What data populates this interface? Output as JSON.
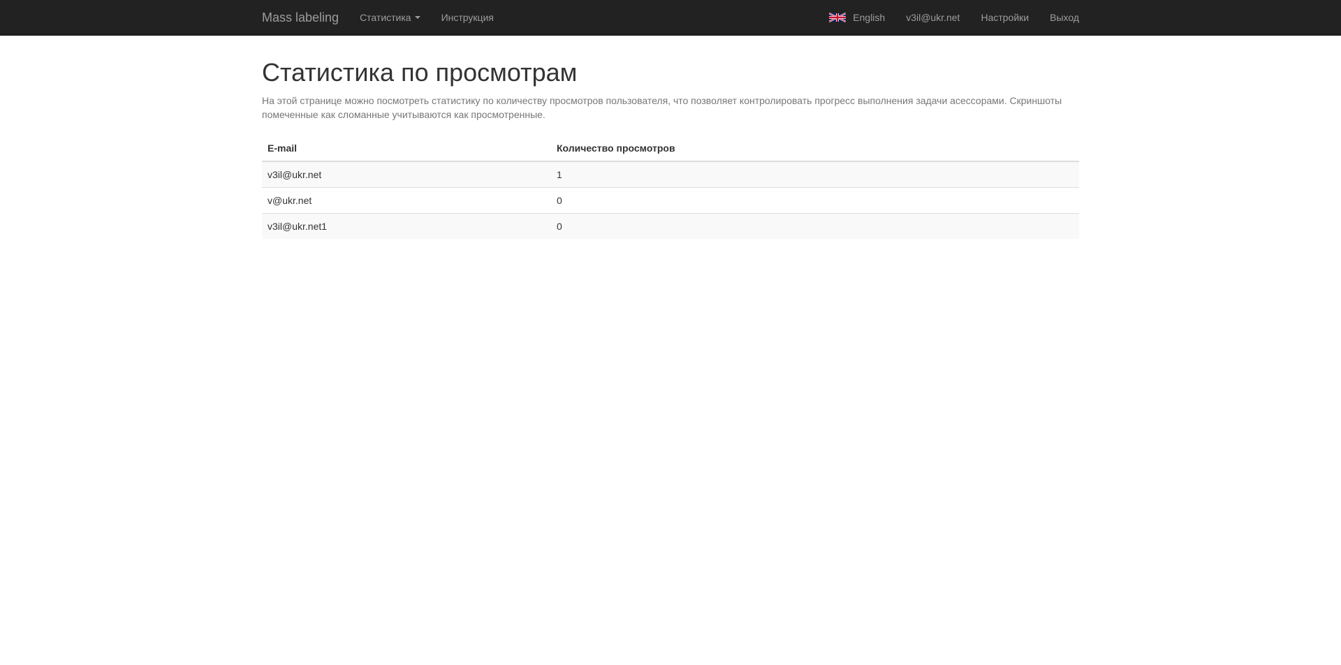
{
  "navbar": {
    "brand": "Mass labeling",
    "left_items": [
      {
        "label": "Статистика",
        "dropdown": true
      },
      {
        "label": "Инструкция"
      }
    ],
    "right_items": [
      {
        "label": "English",
        "icon": "uk-flag-icon"
      },
      {
        "label": "v3il@ukr.net"
      },
      {
        "label": "Настройки"
      },
      {
        "label": "Выход"
      }
    ],
    "colors": {
      "background": "#222222",
      "text": "#9d9d9d"
    }
  },
  "page": {
    "title": "Статистика по просмотрам",
    "description": "На этой странице можно посмотреть статистику по количеству просмотров пользователя, что позволяет контролировать прогресс выполнения задачи асессорами. Скриншоты помеченные как сломанные учитываются как просмотренные."
  },
  "table": {
    "headers": [
      "E-mail",
      "Количество просмотров"
    ],
    "rows": [
      [
        "v3il@ukr.net",
        "1"
      ],
      [
        "v@ukr.net",
        "0"
      ],
      [
        "v3il@ukr.net1",
        "0"
      ]
    ]
  }
}
